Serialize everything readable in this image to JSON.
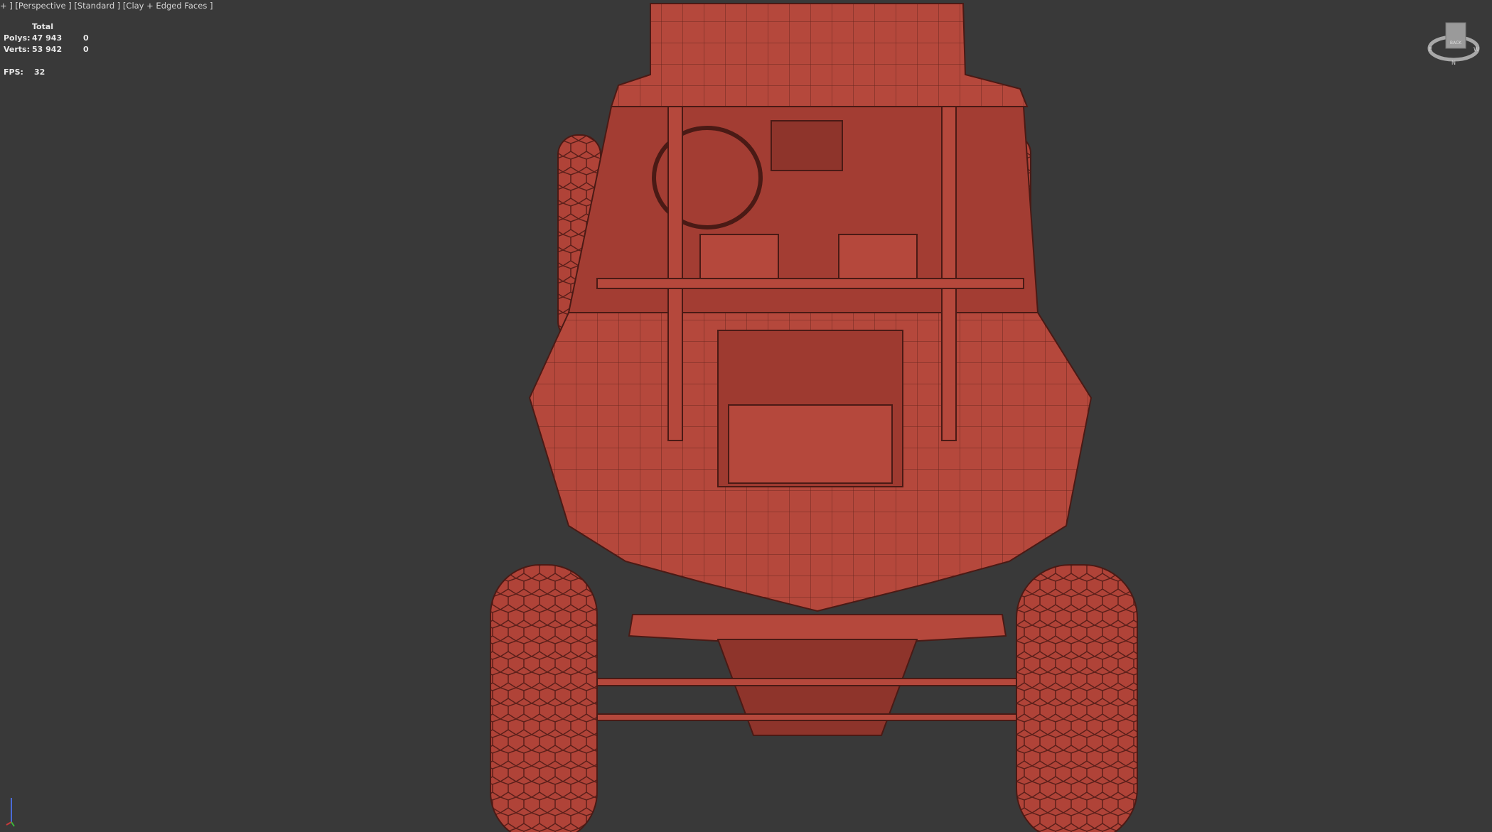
{
  "viewport": {
    "label": "+ ] [Perspective ] [Standard ] [Clay + Edged Faces ]",
    "stats": {
      "header": "Total",
      "polys_label": "Polys:",
      "polys_total": "47 943",
      "polys_selected": "0",
      "verts_label": "Verts:",
      "verts_total": "53 942",
      "verts_selected": "0",
      "fps_label": "FPS:",
      "fps_value": "32"
    },
    "viewcube": {
      "face": "BACK",
      "compass": [
        "E",
        "W",
        "N"
      ]
    },
    "colors": {
      "background": "#393939",
      "clay": "#b5483c",
      "edges": "#5a1f1a"
    }
  }
}
